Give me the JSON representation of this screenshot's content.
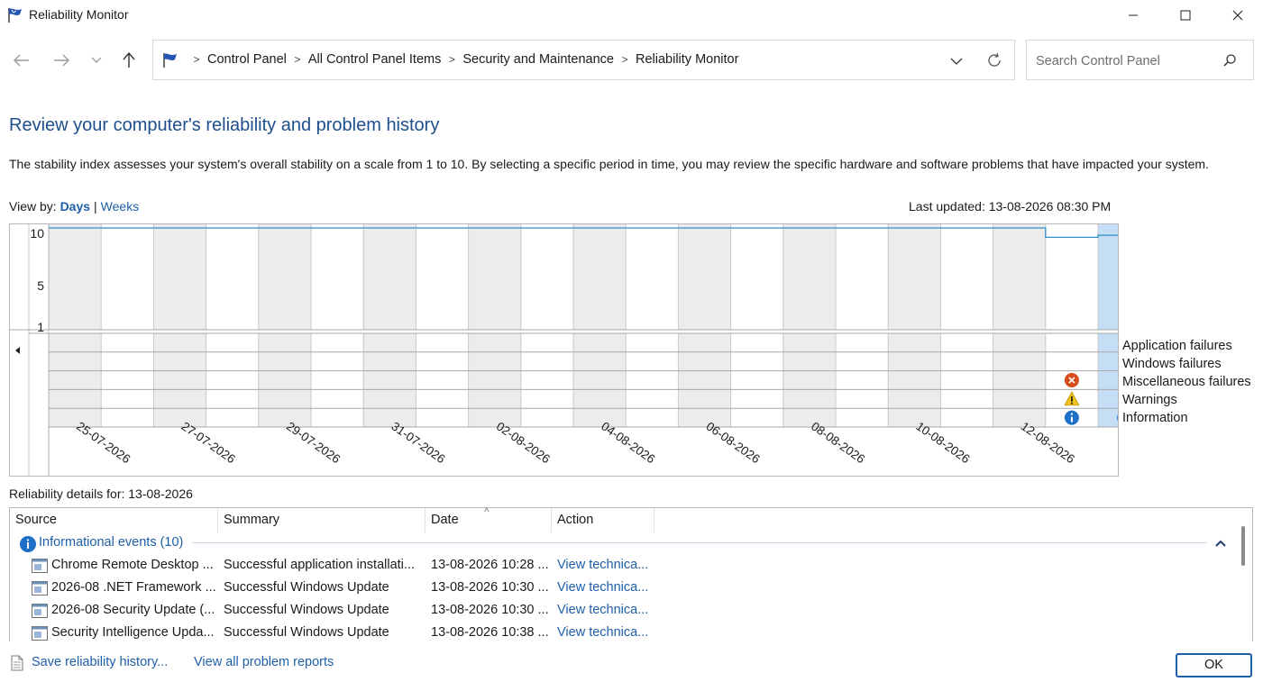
{
  "window": {
    "title": "Reliability Monitor"
  },
  "address": {
    "crumbs": [
      "Control Panel",
      "All Control Panel Items",
      "Security and Maintenance",
      "Reliability Monitor"
    ]
  },
  "search": {
    "placeholder": "Search Control Panel"
  },
  "header": {
    "title": "Review your computer's reliability and problem history",
    "description": "The stability index assesses your system's overall stability on a scale from 1 to 10. By selecting a specific period in time, you may review the specific hardware and software problems that have impacted your system.",
    "view_by_label": "View by:",
    "view_days": "Days",
    "view_separator": "|",
    "view_weeks": "Weeks",
    "last_updated": "Last updated: 13-08-2026 08:30 PM"
  },
  "chart_data": {
    "type": "line",
    "y_ticks": [
      "10",
      "5",
      "1"
    ],
    "x_tick_labels": [
      "25-07-2026",
      "27-07-2026",
      "29-07-2026",
      "31-07-2026",
      "02-08-2026",
      "04-08-2026",
      "06-08-2026",
      "08-08-2026",
      "10-08-2026",
      "12-08-2026"
    ],
    "series": [
      {
        "values": [
          10,
          10,
          10,
          10,
          10,
          10,
          10,
          10,
          10,
          10,
          10,
          10,
          10,
          10,
          10,
          10,
          10,
          10,
          10,
          9.1,
          9.3
        ]
      }
    ],
    "ylim": [
      1,
      10
    ],
    "selected_day": "13-08-2026",
    "event_rows": [
      "Application failures",
      "Windows failures",
      "Miscellaneous failures",
      "Warnings",
      "Information"
    ],
    "events": [
      {
        "date": "12-08-2026",
        "row": "Miscellaneous failures",
        "icon": "error-icon"
      },
      {
        "date": "12-08-2026",
        "row": "Warnings",
        "icon": "warning-icon"
      },
      {
        "date": "12-08-2026",
        "row": "Information",
        "icon": "info-icon"
      },
      {
        "date": "13-08-2026",
        "row": "Information",
        "icon": "info-icon"
      }
    ],
    "grid": true,
    "legend_position": "right"
  },
  "details": {
    "label": "Reliability details for: 13-08-2026",
    "columns": [
      "Source",
      "Summary",
      "Date",
      "Action"
    ],
    "group_label": "Informational events (10)",
    "rows": [
      {
        "source": "Chrome Remote Desktop ...",
        "summary": "Successful application installati...",
        "date": "13-08-2026 10:28 ...",
        "action": "View technica..."
      },
      {
        "source": "2026-08 .NET Framework ...",
        "summary": "Successful Windows Update",
        "date": "13-08-2026 10:30 ...",
        "action": "View technica..."
      },
      {
        "source": "2026-08 Security Update (...",
        "summary": "Successful Windows Update",
        "date": "13-08-2026 10:30 ...",
        "action": "View technica..."
      },
      {
        "source": "Security Intelligence Upda...",
        "summary": "Successful Windows Update",
        "date": "13-08-2026 10:38 ...",
        "action": "View technica..."
      }
    ]
  },
  "footer": {
    "save_link": "Save reliability history...",
    "problems_link": "View all problem reports",
    "ok_label": "OK"
  },
  "colors": {
    "accent": "#1e5fa8",
    "title": "#1e4e8c",
    "selected_column": "#c5def5",
    "shaded_column": "#ececec",
    "line": "#2d8ec9"
  }
}
